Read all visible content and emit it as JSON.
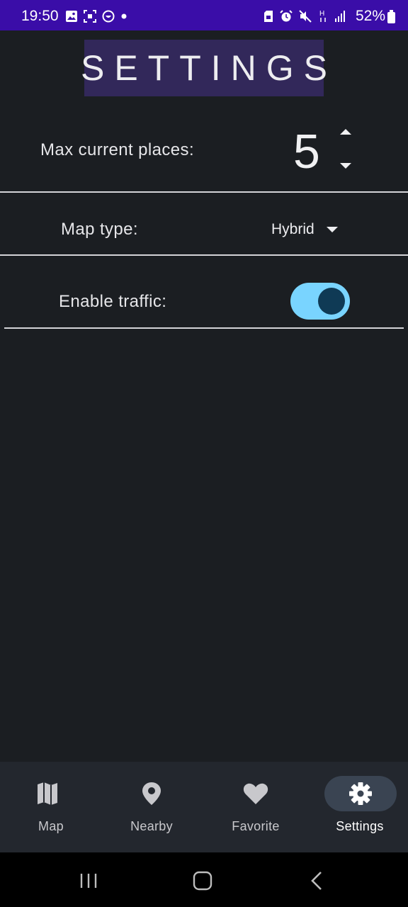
{
  "status_bar": {
    "time": "19:50",
    "battery": "52%",
    "left_icons": [
      "gallery-icon",
      "screenshot-icon",
      "smile-icon",
      "dot-icon"
    ],
    "right_icons": [
      "sim-icon",
      "alarm-icon",
      "mute-icon",
      "network-h-icon",
      "signal-icon",
      "battery-icon"
    ]
  },
  "header": {
    "title": "SETTINGS"
  },
  "settings": {
    "max_places": {
      "label": "Max current places:",
      "value": "5"
    },
    "map_type": {
      "label": "Map type:",
      "value": "Hybrid"
    },
    "traffic": {
      "label": "Enable traffic:",
      "enabled": true
    }
  },
  "bottom_nav": {
    "items": [
      {
        "label": "Map",
        "icon": "map-icon",
        "active": false
      },
      {
        "label": "Nearby",
        "icon": "location-pin-icon",
        "active": false
      },
      {
        "label": "Favorite",
        "icon": "heart-icon",
        "active": false
      },
      {
        "label": "Settings",
        "icon": "gear-icon",
        "active": true
      }
    ]
  },
  "system_nav": {
    "buttons": [
      "recents-icon",
      "home-icon",
      "back-icon"
    ]
  },
  "colors": {
    "status_bar": "#3a0da8",
    "background": "#1b1e22",
    "title_bg": "#32285a",
    "toggle_track": "#79d4ff",
    "toggle_knob": "#0f3a55",
    "nav_bg": "#23272e",
    "nav_active_pill": "#3a4452"
  }
}
